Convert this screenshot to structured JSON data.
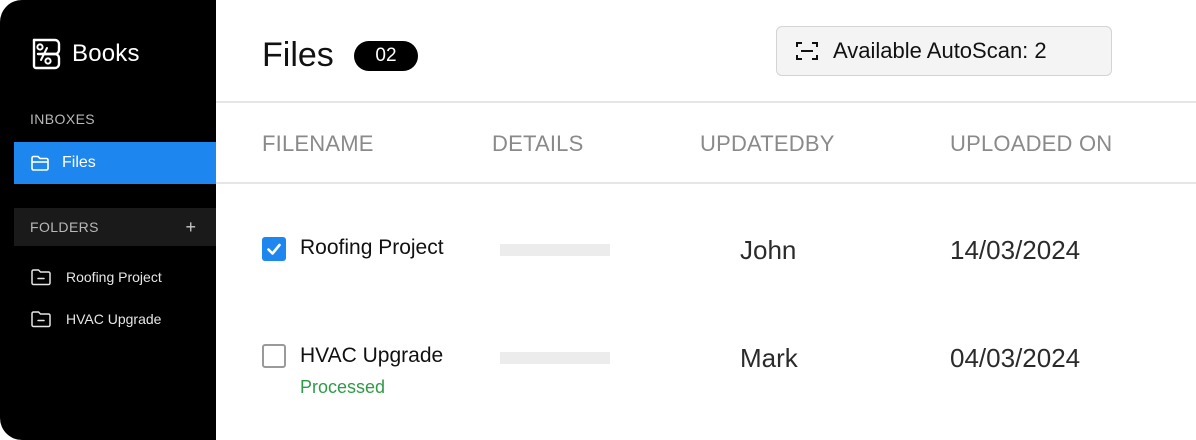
{
  "brand": {
    "name": "Books",
    "icon": "books-logo-icon"
  },
  "sidebar": {
    "inboxes_label": "INBOXES",
    "active_item": {
      "label": "Files",
      "icon": "folder-open-icon"
    },
    "folders_label": "FOLDERS",
    "add_icon": "+",
    "folders": [
      {
        "label": "Roofing Project",
        "icon": "folder-icon"
      },
      {
        "label": "HVAC Upgrade",
        "icon": "folder-icon"
      }
    ]
  },
  "header": {
    "title": "Files",
    "count": "02",
    "autoscan_label": "Available AutoScan: 2",
    "autoscan_icon": "scan-icon"
  },
  "table": {
    "columns": [
      "FILENAME",
      "DETAILS",
      "UPDATEDBY",
      "UPLOADED ON"
    ],
    "rows": [
      {
        "filename": "Roofing Project",
        "checked": true,
        "status": "",
        "updated_by": "John",
        "uploaded_on": "14/03/2024"
      },
      {
        "filename": "HVAC Upgrade",
        "checked": false,
        "status": "Processed",
        "updated_by": "Mark",
        "uploaded_on": "04/03/2024"
      }
    ]
  },
  "colors": {
    "accent": "#1e86ef",
    "sidebar_bg": "#000000",
    "status_green": "#2f9b48"
  }
}
